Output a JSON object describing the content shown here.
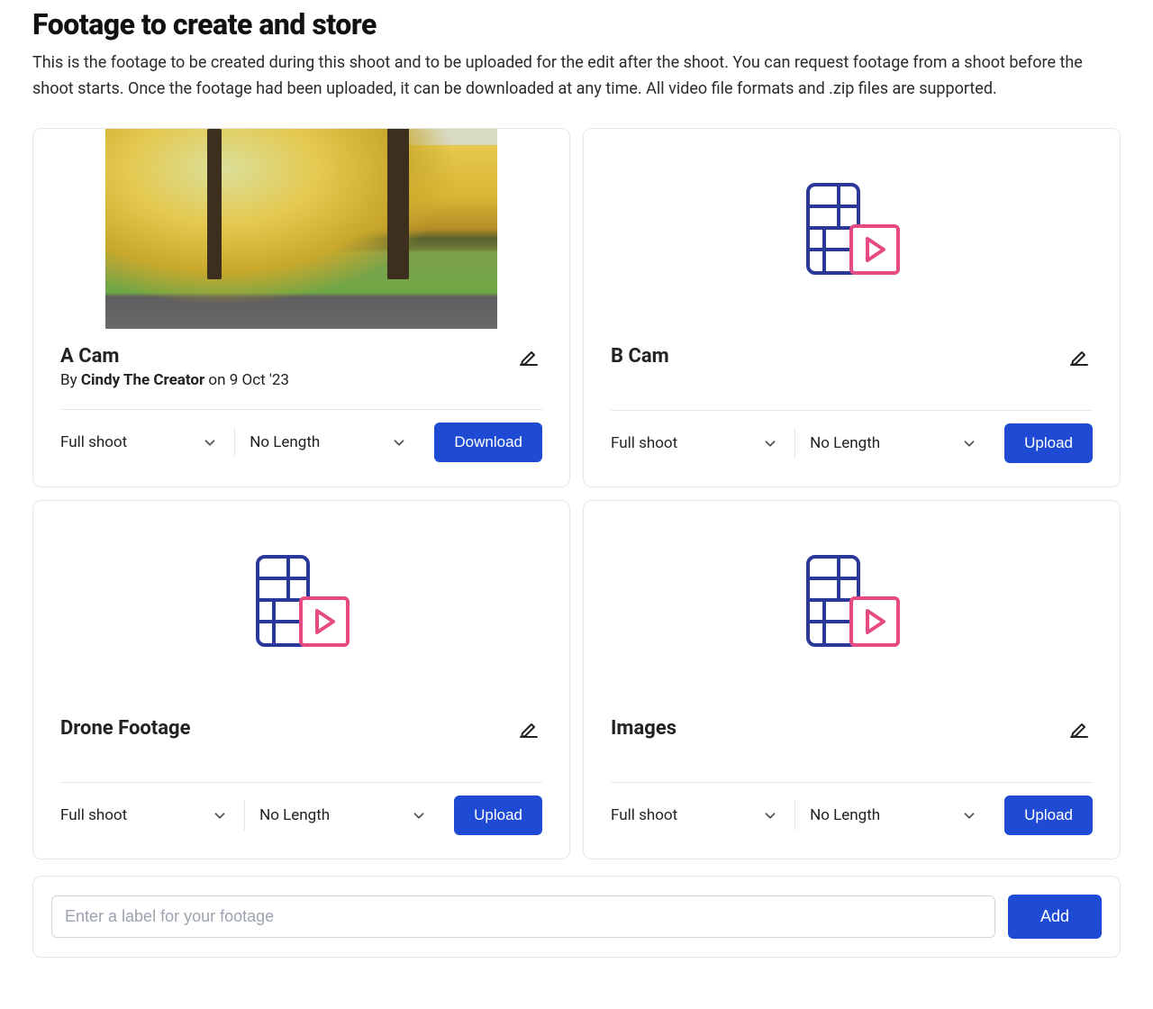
{
  "header": {
    "title": "Footage to create and store",
    "description": "This is the footage to be created during this shoot and to be uploaded for the edit after the shoot. You can request footage from a shoot before the shoot starts. Once the footage had been uploaded, it can be downloaded at any time. All video file formats and .zip files are supported."
  },
  "cards": [
    {
      "title": "A Cam",
      "by_prefix": "By ",
      "creator": "Cindy The Creator",
      "date_prefix": " on ",
      "date": "9 Oct '23",
      "shoot_select": "Full shoot",
      "length_select": "No Length",
      "action": "Download"
    },
    {
      "title": "B Cam",
      "shoot_select": "Full shoot",
      "length_select": "No Length",
      "action": "Upload"
    },
    {
      "title": "Drone Footage",
      "shoot_select": "Full shoot",
      "length_select": "No Length",
      "action": "Upload"
    },
    {
      "title": "Images",
      "shoot_select": "Full shoot",
      "length_select": "No Length",
      "action": "Upload"
    }
  ],
  "add_bar": {
    "placeholder": "Enter a label for your footage",
    "button": "Add"
  },
  "colors": {
    "primary": "#1f4bd4",
    "icon_stroke": "#2a3899",
    "icon_accent": "#e54b82"
  }
}
